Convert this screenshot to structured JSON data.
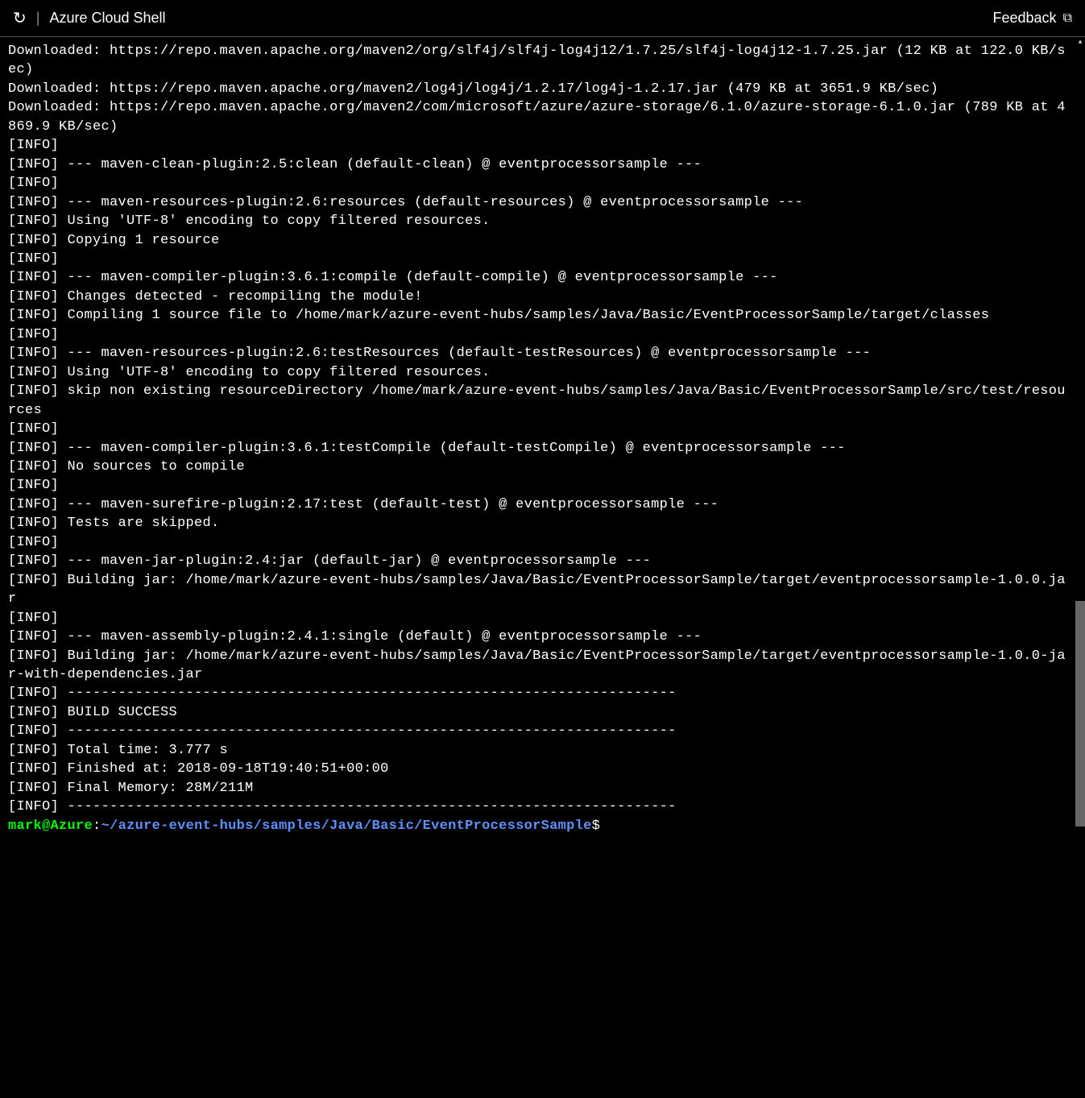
{
  "header": {
    "title": "Azure Cloud Shell",
    "feedback_label": "Feedback"
  },
  "terminal": {
    "lines": [
      "Downloaded: https://repo.maven.apache.org/maven2/org/slf4j/slf4j-log4j12/1.7.25/slf4j-log4j12-1.7.25.jar (12 KB at 122.0 KB/sec)",
      "Downloaded: https://repo.maven.apache.org/maven2/log4j/log4j/1.2.17/log4j-1.2.17.jar (479 KB at 3651.9 KB/sec)",
      "Downloaded: https://repo.maven.apache.org/maven2/com/microsoft/azure/azure-storage/6.1.0/azure-storage-6.1.0.jar (789 KB at 4869.9 KB/sec)",
      "[INFO]",
      "[INFO] --- maven-clean-plugin:2.5:clean (default-clean) @ eventprocessorsample ---",
      "[INFO]",
      "[INFO] --- maven-resources-plugin:2.6:resources (default-resources) @ eventprocessorsample ---",
      "[INFO] Using 'UTF-8' encoding to copy filtered resources.",
      "[INFO] Copying 1 resource",
      "[INFO]",
      "[INFO] --- maven-compiler-plugin:3.6.1:compile (default-compile) @ eventprocessorsample ---",
      "[INFO] Changes detected - recompiling the module!",
      "[INFO] Compiling 1 source file to /home/mark/azure-event-hubs/samples/Java/Basic/EventProcessorSample/target/classes",
      "[INFO]",
      "[INFO] --- maven-resources-plugin:2.6:testResources (default-testResources) @ eventprocessorsample ---",
      "[INFO] Using 'UTF-8' encoding to copy filtered resources.",
      "[INFO] skip non existing resourceDirectory /home/mark/azure-event-hubs/samples/Java/Basic/EventProcessorSample/src/test/resources",
      "[INFO]",
      "[INFO] --- maven-compiler-plugin:3.6.1:testCompile (default-testCompile) @ eventprocessorsample ---",
      "[INFO] No sources to compile",
      "[INFO]",
      "[INFO] --- maven-surefire-plugin:2.17:test (default-test) @ eventprocessorsample ---",
      "[INFO] Tests are skipped.",
      "[INFO]",
      "[INFO] --- maven-jar-plugin:2.4:jar (default-jar) @ eventprocessorsample ---",
      "[INFO] Building jar: /home/mark/azure-event-hubs/samples/Java/Basic/EventProcessorSample/target/eventprocessorsample-1.0.0.jar",
      "[INFO]",
      "[INFO] --- maven-assembly-plugin:2.4.1:single (default) @ eventprocessorsample ---",
      "[INFO] Building jar: /home/mark/azure-event-hubs/samples/Java/Basic/EventProcessorSample/target/eventprocessorsample-1.0.0-jar-with-dependencies.jar",
      "[INFO] ------------------------------------------------------------------------",
      "[INFO] BUILD SUCCESS",
      "[INFO] ------------------------------------------------------------------------",
      "[INFO] Total time: 3.777 s",
      "[INFO] Finished at: 2018-09-18T19:40:51+00:00",
      "[INFO] Final Memory: 28M/211M",
      "[INFO] ------------------------------------------------------------------------"
    ],
    "prompt": {
      "user": "mark",
      "at": "@",
      "host": "Azure",
      "colon": ":",
      "path": "~/azure-event-hubs/samples/Java/Basic/EventProcessorSample",
      "dollar": "$"
    }
  }
}
